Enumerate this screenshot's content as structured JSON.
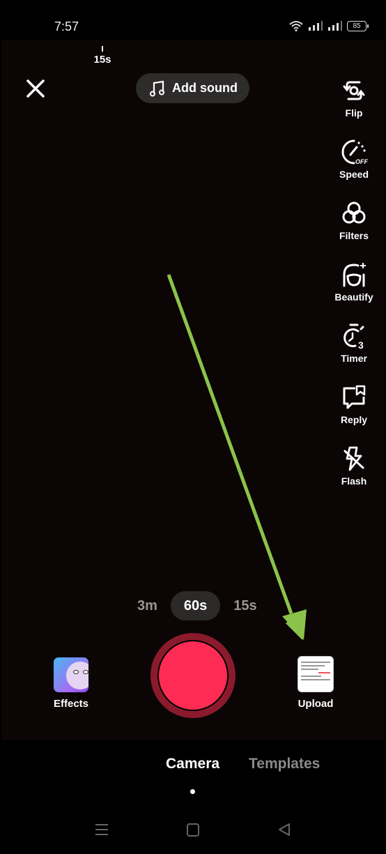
{
  "status_bar": {
    "time": "7:57",
    "battery": "85",
    "icons": [
      "wifi-icon",
      "signal-icon",
      "signal-icon",
      "battery-icon"
    ]
  },
  "recorder": {
    "timeline_marker": "15s",
    "add_sound_label": "Add sound",
    "side_tools": [
      {
        "id": "flip",
        "label": "Flip",
        "icon": "flip-camera-icon"
      },
      {
        "id": "speed",
        "label": "Speed",
        "icon": "speed-off-icon"
      },
      {
        "id": "filters",
        "label": "Filters",
        "icon": "filters-icon"
      },
      {
        "id": "beautify",
        "label": "Beautify",
        "icon": "beautify-icon"
      },
      {
        "id": "timer",
        "label": "Timer",
        "icon": "timer-3-icon"
      },
      {
        "id": "reply",
        "label": "Reply",
        "icon": "reply-icon"
      },
      {
        "id": "flash",
        "label": "Flash",
        "icon": "flash-off-icon"
      }
    ],
    "durations": [
      {
        "label": "3m",
        "active": false
      },
      {
        "label": "60s",
        "active": true
      },
      {
        "label": "15s",
        "active": false
      }
    ],
    "effects_label": "Effects",
    "upload_label": "Upload"
  },
  "bottom_tabs": [
    {
      "label": "Camera",
      "active": true
    },
    {
      "label": "Templates",
      "active": false
    }
  ],
  "nav_bar": [
    "menu-icon",
    "home-icon",
    "back-icon"
  ],
  "annotation": {
    "arrow_color": "#8bc34a",
    "points_to": "Upload"
  },
  "colors": {
    "record_red": "#fe2c55",
    "record_ring": "#8b1a2d",
    "camera_bg": "#0c0506"
  }
}
